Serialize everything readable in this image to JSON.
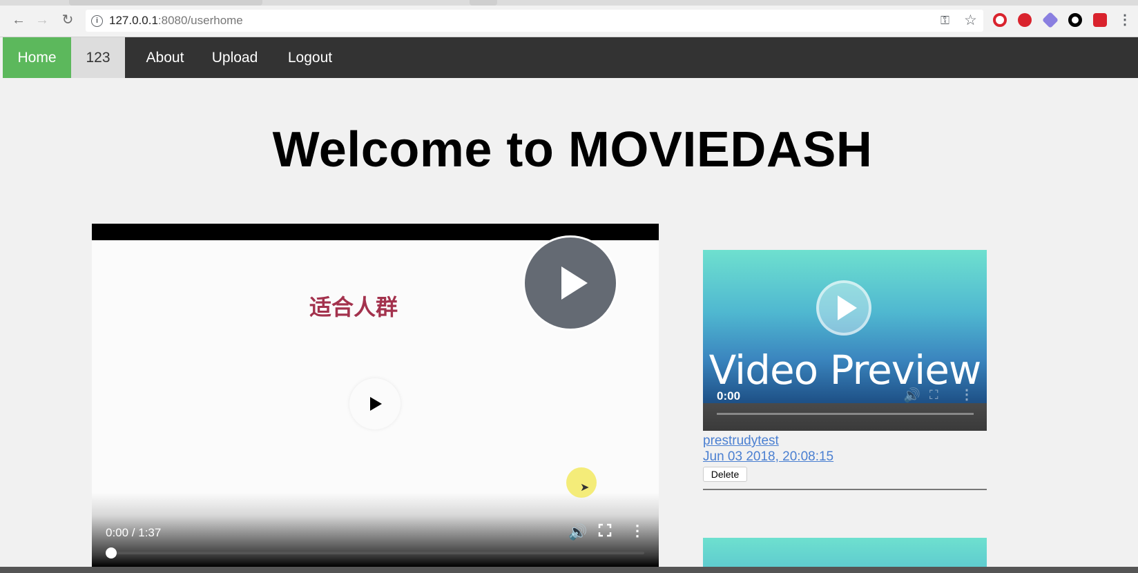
{
  "browser": {
    "url_host": "127.0.0.1",
    "url_path": ":8080/userhome"
  },
  "navbar": {
    "home": "Home",
    "user": "123",
    "about": "About",
    "upload": "Upload",
    "logout": "Logout"
  },
  "page": {
    "title": "Welcome to MOVIEDASH"
  },
  "main_video": {
    "caption": "适合人群",
    "time": "0:00 / 1:37"
  },
  "sidebar_video": {
    "preview_text": "Video Preview",
    "time": "0:00",
    "title": "prestrudytest",
    "date": "Jun 03 2018, 20:08:15",
    "delete_label": "Delete"
  },
  "colors": {
    "home_active": "#5cb85c",
    "navbar_bg": "#333333",
    "link": "#4a7fd1",
    "caption": "#a3324d"
  }
}
